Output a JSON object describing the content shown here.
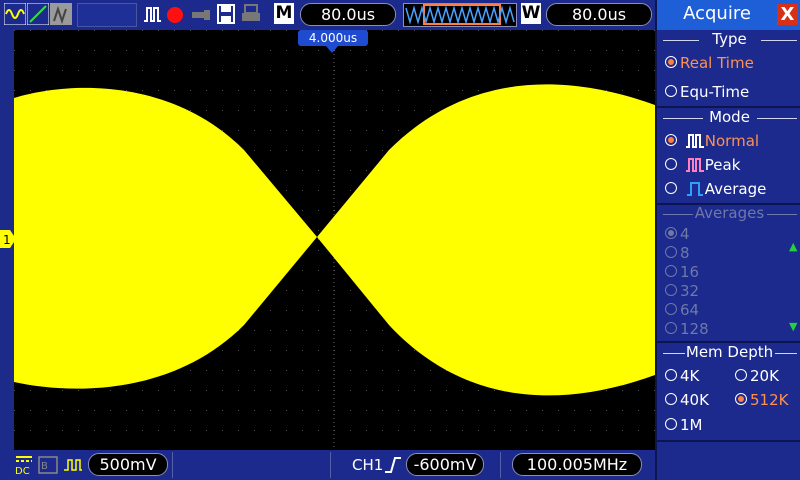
{
  "top_bar": {
    "m_label": "M",
    "m_time": "80.0us",
    "w_label": "W",
    "w_time": "80.0us",
    "trigger_position": "4.000us"
  },
  "bottom_bar": {
    "volts_div": "500mV",
    "trigger_channel": "CH1",
    "trigger_level": "-600mV",
    "frequency": "100.005MHz"
  },
  "panel": {
    "title": "Acquire",
    "close": "X",
    "type": {
      "title": "Type",
      "options": [
        "Real Time",
        "Equ-Time"
      ],
      "selected": "Real Time"
    },
    "mode": {
      "title": "Mode",
      "options": [
        "Normal",
        "Peak",
        "Average"
      ],
      "selected": "Normal"
    },
    "averages": {
      "title": "Averages",
      "options": [
        "4",
        "8",
        "16",
        "32",
        "64",
        "128"
      ],
      "selected": "4",
      "enabled": false
    },
    "mem_depth": {
      "title": "Mem Depth",
      "options": [
        "4K",
        "20K",
        "40K",
        "512K",
        "1M"
      ],
      "selected": "512K"
    }
  },
  "colors": {
    "trace": "#ffff00",
    "accent": "#1e5ed6",
    "selected": "#ff9050"
  },
  "icons": [
    "channel-wave-icon",
    "run-icon",
    "record-icon",
    "usb-icon",
    "save-icon",
    "print-icon"
  ]
}
